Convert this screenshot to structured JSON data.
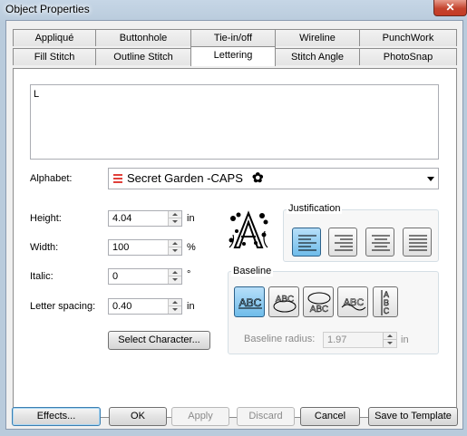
{
  "window": {
    "title": "Object Properties",
    "close_glyph": "✕"
  },
  "tabs": {
    "row1": [
      "Appliqué",
      "Buttonhole",
      "Tie-in/off",
      "Wireline",
      "PunchWork"
    ],
    "row2": [
      "Fill Stitch",
      "Outline Stitch",
      "Lettering",
      "Stitch Angle",
      "PhotoSnap"
    ],
    "active": "Lettering"
  },
  "lettering": {
    "text_value": "L",
    "alphabet_label": "Alphabet:",
    "alphabet_value": "Secret Garden -CAPS",
    "alphabet_icon": "multi-stitch-font-icon",
    "height_label": "Height:",
    "height_value": "4.04",
    "height_unit": "in",
    "width_label": "Width:",
    "width_value": "100",
    "width_unit": "%",
    "italic_label": "Italic:",
    "italic_value": "0",
    "italic_unit": "°",
    "spacing_label": "Letter spacing:",
    "spacing_value": "0.40",
    "spacing_unit": "in",
    "select_character_label": "Select Character...",
    "justification_label": "Justification",
    "justification_selected": "left",
    "baseline_label": "Baseline",
    "baseline_selected": "straight",
    "baseline_sample_text": "ABC",
    "baseline_radius_label": "Baseline radius:",
    "baseline_radius_value": "1.97",
    "baseline_radius_unit": "in"
  },
  "footer": {
    "effects": "Effects...",
    "ok": "OK",
    "apply": "Apply",
    "discard": "Discard",
    "cancel": "Cancel",
    "save_template": "Save to Template"
  },
  "colors": {
    "selected_button": "#6fbcea",
    "close_button": "#c4442e"
  }
}
